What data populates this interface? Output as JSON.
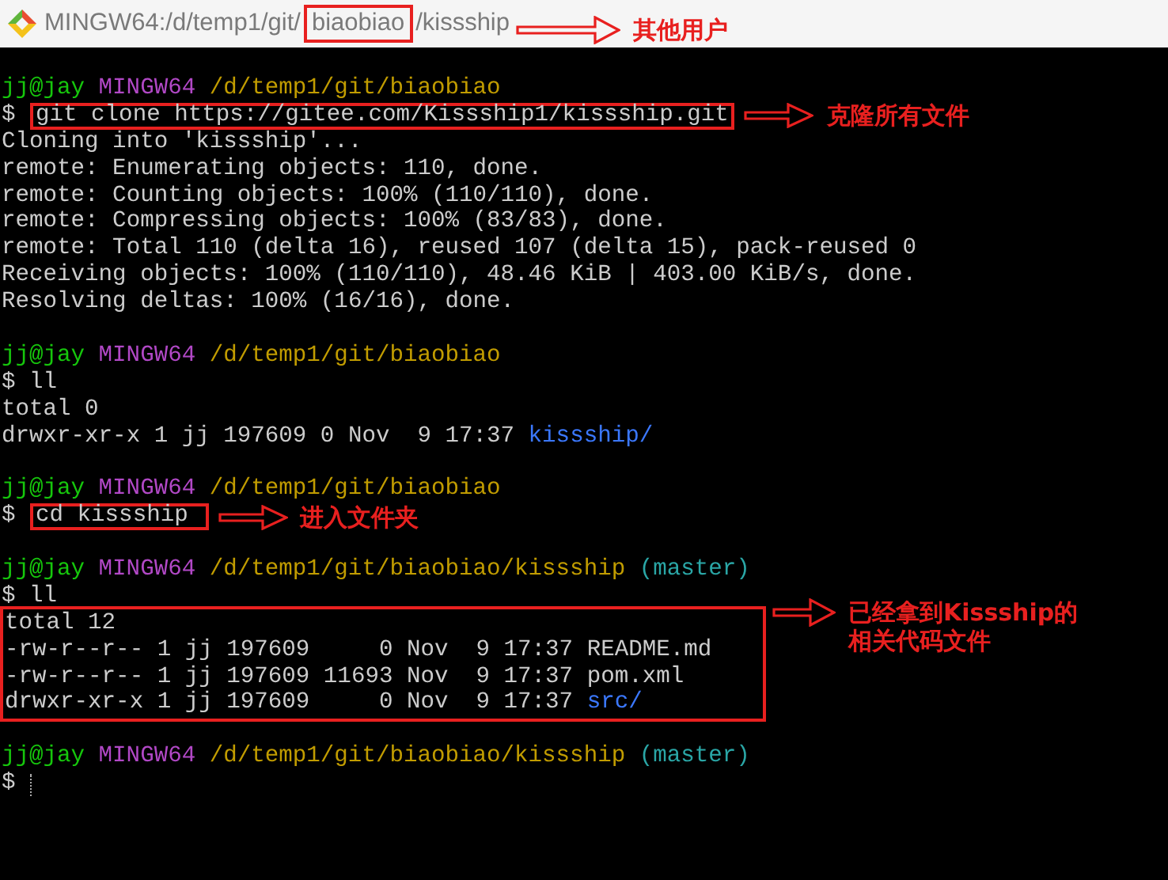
{
  "window": {
    "title": [
      {
        "text": "MINGW64:/d/temp1/git/",
        "boxed": false
      },
      {
        "text": "biaobiao",
        "boxed": true
      },
      {
        "text": "/kissship",
        "boxed": false
      }
    ],
    "note": [
      "其他用户"
    ]
  },
  "terminal": {
    "entries": [
      {
        "kind": "line",
        "segments": [
          {
            "kind": "user",
            "text": "jj@jay"
          },
          {
            "kind": "host",
            "text": "MINGW64"
          },
          {
            "kind": "path",
            "text": "/d/temp1/git/biaobiao"
          }
        ]
      },
      {
        "kind": "line",
        "segments": [
          {
            "kind": "text",
            "text": "$ "
          },
          {
            "kind": "command",
            "text": "git clone https://gitee.com/Kissship1/kissship.git",
            "boxed": true
          }
        ],
        "note": [
          "克隆所有文件"
        ]
      },
      {
        "kind": "line",
        "segments": [
          {
            "kind": "text",
            "text": "Cloning into 'kissship'..."
          }
        ]
      },
      {
        "kind": "line",
        "segments": [
          {
            "kind": "text",
            "text": "remote: Enumerating objects: 110, done."
          }
        ]
      },
      {
        "kind": "line",
        "segments": [
          {
            "kind": "text",
            "text": "remote: Counting objects: 100% (110/110), done."
          }
        ]
      },
      {
        "kind": "line",
        "segments": [
          {
            "kind": "text",
            "text": "remote: Compressing objects: 100% (83/83), done."
          }
        ]
      },
      {
        "kind": "line",
        "segments": [
          {
            "kind": "text",
            "text": "remote: Total 110 (delta 16), reused 107 (delta 15), pack-reused 0"
          }
        ]
      },
      {
        "kind": "line",
        "segments": [
          {
            "kind": "text",
            "text": "Receiving objects: 100% (110/110), 48.46 KiB | 403.00 KiB/s, done."
          }
        ]
      },
      {
        "kind": "line",
        "segments": [
          {
            "kind": "text",
            "text": "Resolving deltas: 100% (16/16), done."
          }
        ]
      },
      {
        "kind": "blank"
      },
      {
        "kind": "line",
        "segments": [
          {
            "kind": "user",
            "text": "jj@jay"
          },
          {
            "kind": "host",
            "text": "MINGW64"
          },
          {
            "kind": "path",
            "text": "/d/temp1/git/biaobiao"
          }
        ]
      },
      {
        "kind": "line",
        "segments": [
          {
            "kind": "text",
            "text": "$ ll"
          }
        ]
      },
      {
        "kind": "line",
        "segments": [
          {
            "kind": "text",
            "text": "total 0"
          }
        ]
      },
      {
        "kind": "line",
        "segments": [
          {
            "kind": "text",
            "text": "drwxr-xr-x 1 jj 197609 0 Nov  9 17:37 "
          },
          {
            "kind": "dir",
            "text": "kissship/"
          }
        ]
      },
      {
        "kind": "blank"
      },
      {
        "kind": "line",
        "segments": [
          {
            "kind": "user",
            "text": "jj@jay"
          },
          {
            "kind": "host",
            "text": "MINGW64"
          },
          {
            "kind": "path",
            "text": "/d/temp1/git/biaobiao"
          }
        ]
      },
      {
        "kind": "line",
        "segments": [
          {
            "kind": "text",
            "text": "$ "
          },
          {
            "kind": "command",
            "text": "cd kissship ",
            "boxed": true
          }
        ],
        "note": [
          "进入文件夹"
        ]
      },
      {
        "kind": "blank"
      },
      {
        "kind": "line",
        "segments": [
          {
            "kind": "user",
            "text": "jj@jay"
          },
          {
            "kind": "host",
            "text": "MINGW64"
          },
          {
            "kind": "path",
            "text": "/d/temp1/git/biaobiao/kissship"
          },
          {
            "kind": "branch",
            "text": "(master)"
          }
        ]
      },
      {
        "kind": "line",
        "segments": [
          {
            "kind": "text",
            "text": "$ ll"
          }
        ]
      },
      {
        "kind": "block",
        "boxed": true,
        "note": [
          "已经拿到Kissship的",
          "相关代码文件"
        ],
        "lines": [
          [
            {
              "kind": "text",
              "text": "total 12"
            }
          ],
          [
            {
              "kind": "text",
              "text": "-rw-r--r-- 1 jj 197609     0 Nov  9 17:37 README.md"
            }
          ],
          [
            {
              "kind": "text",
              "text": "-rw-r--r-- 1 jj 197609 11693 Nov  9 17:37 pom.xml"
            }
          ],
          [
            {
              "kind": "text",
              "text": "drwxr-xr-x 1 jj 197609     0 Nov  9 17:37 "
            },
            {
              "kind": "dir",
              "text": "src/"
            }
          ]
        ]
      },
      {
        "kind": "blank"
      },
      {
        "kind": "line",
        "segments": [
          {
            "kind": "user",
            "text": "jj@jay"
          },
          {
            "kind": "host",
            "text": "MINGW64"
          },
          {
            "kind": "path",
            "text": "/d/temp1/git/biaobiao/kissship"
          },
          {
            "kind": "branch",
            "text": "(master)"
          }
        ]
      },
      {
        "kind": "line",
        "segments": [
          {
            "kind": "text",
            "text": "$ "
          },
          {
            "kind": "cursor"
          }
        ]
      }
    ]
  }
}
